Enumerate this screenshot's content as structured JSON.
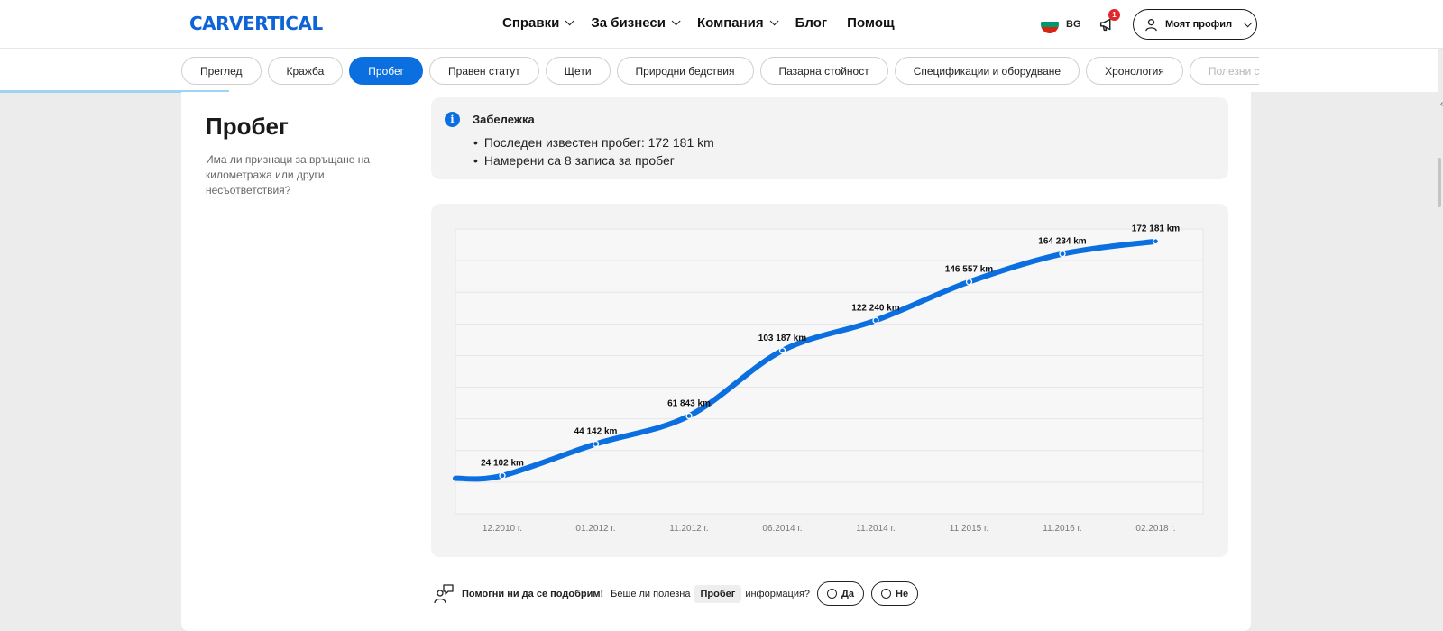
{
  "header": {
    "logo": "CARVERTICAL",
    "nav": [
      {
        "label": "Справки",
        "dropdown": true
      },
      {
        "label": "За бизнеси",
        "dropdown": true
      },
      {
        "label": "Компания",
        "dropdown": true
      },
      {
        "label": "Блог",
        "dropdown": false
      },
      {
        "label": "Помощ",
        "dropdown": false
      }
    ],
    "language": "BG",
    "notification_count": "1",
    "profile_label": "Моят профил"
  },
  "tabs": [
    {
      "label": "Преглед",
      "active": false
    },
    {
      "label": "Кражба",
      "active": false
    },
    {
      "label": "Пробег",
      "active": true
    },
    {
      "label": "Правен статут",
      "active": false
    },
    {
      "label": "Щети",
      "active": false
    },
    {
      "label": "Природни бедствия",
      "active": false
    },
    {
      "label": "Пазарна стойност",
      "active": false
    },
    {
      "label": "Спецификации и оборудване",
      "active": false
    },
    {
      "label": "Хронология",
      "active": false
    },
    {
      "label": "Полезни съв",
      "active": false
    }
  ],
  "section": {
    "title": "Пробег",
    "description": "Има ли признаци за връщане на километража или други несъответствия?"
  },
  "note": {
    "title": "Забележка",
    "items": [
      "Последен известен пробег: 172 181 km",
      "Намерени са 8 записа за пробег"
    ]
  },
  "chart_data": {
    "type": "line",
    "categories": [
      "12.2010 г.",
      "01.2012 г.",
      "11.2012 г.",
      "06.2014 г.",
      "11.2014 г.",
      "11.2015 г.",
      "11.2016 г.",
      "02.2018 г."
    ],
    "values": [
      24102,
      44142,
      61843,
      103187,
      122240,
      146557,
      164234,
      172181
    ],
    "labels": [
      "24 102 km",
      "44 142 km",
      "61 843 km",
      "103 187 km",
      "122 240 km",
      "146 557 km",
      "164 234 km",
      "172 181 km"
    ],
    "ylim": [
      0,
      180000
    ],
    "grid": true,
    "line_color": "#0b6fe0"
  },
  "feedback": {
    "prompt_bold": "Помогни ни да се подобрим!",
    "text_before": "Беше ли полезна",
    "chip": "Пробег",
    "text_after": "информация?",
    "yes": "Да",
    "no": "Не"
  }
}
